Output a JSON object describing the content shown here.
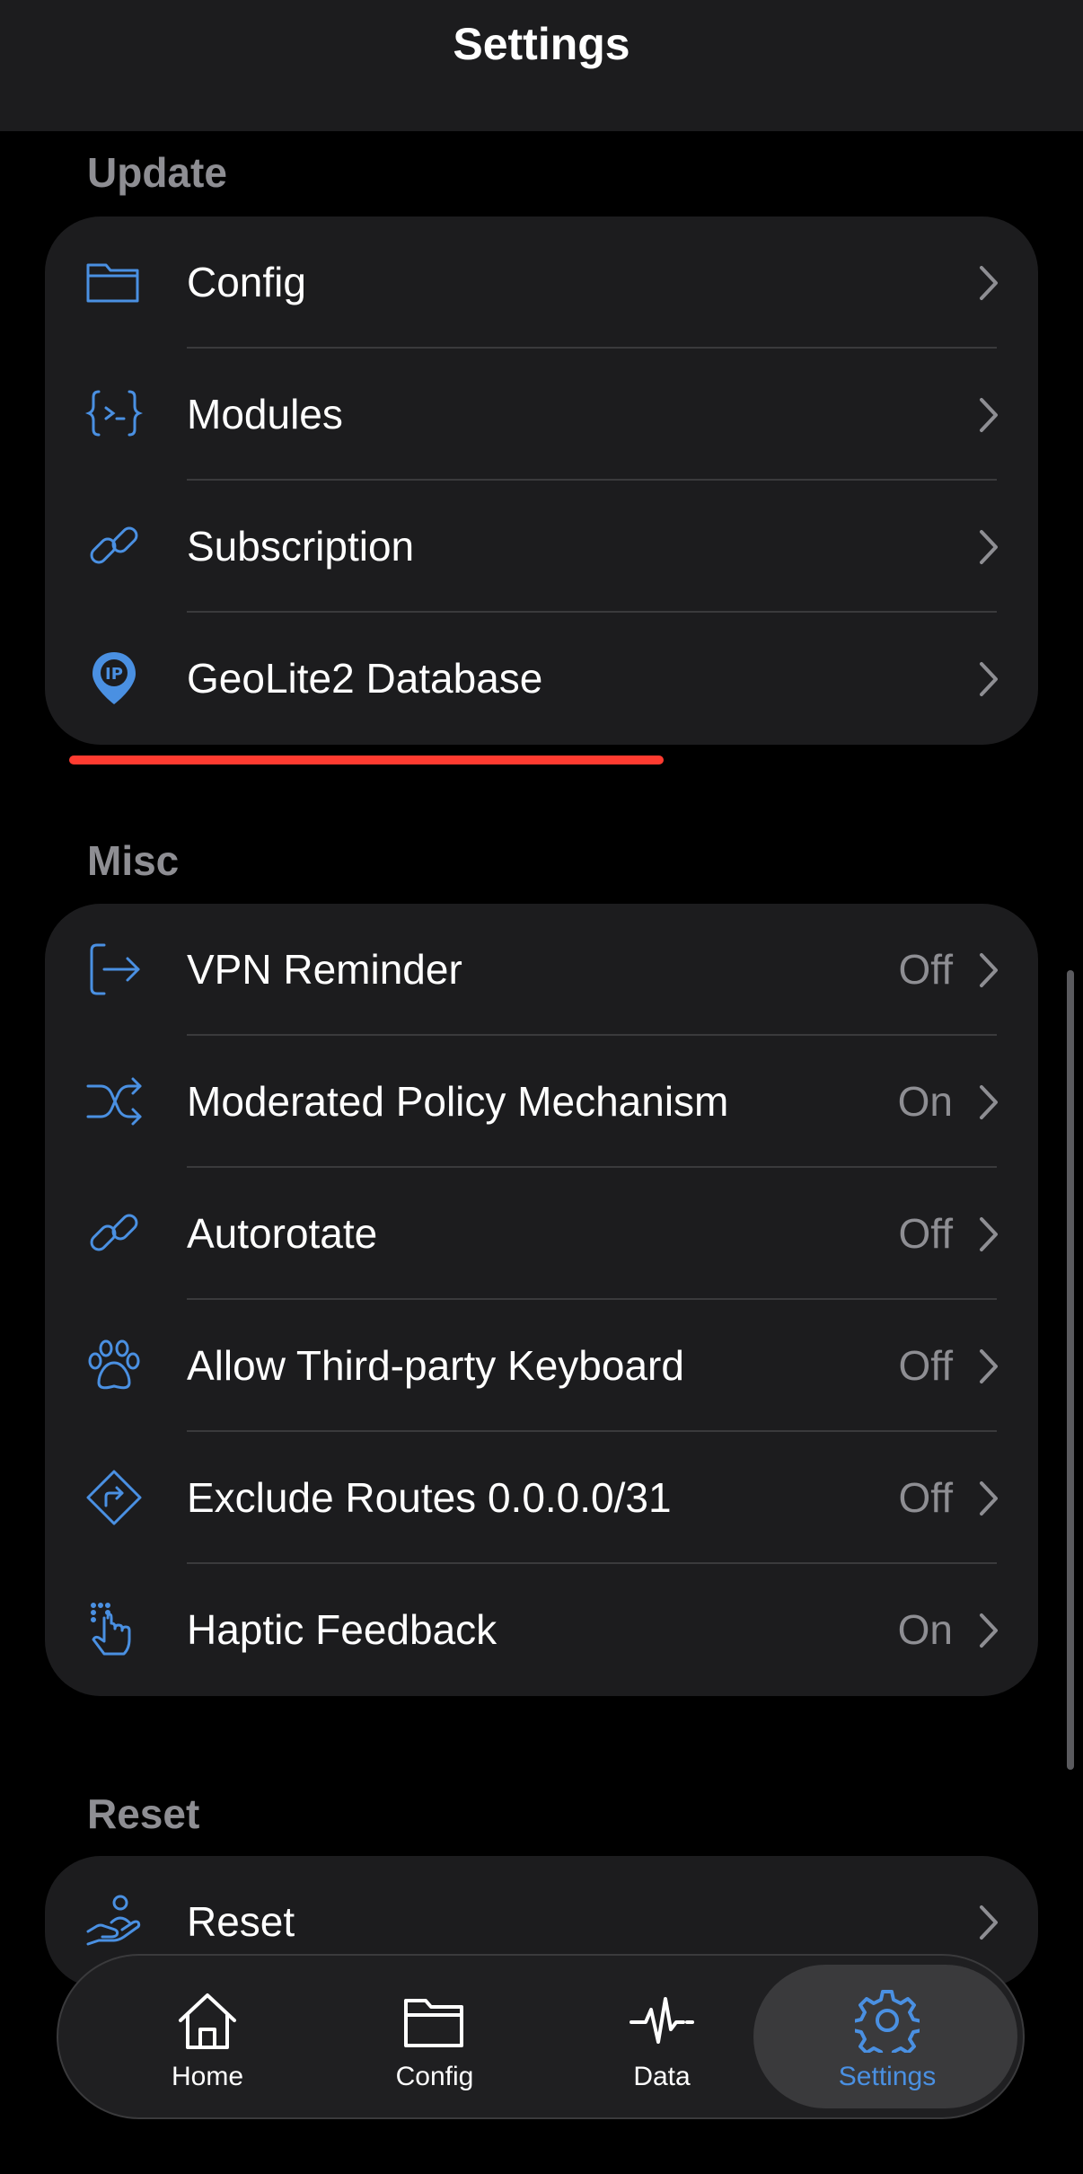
{
  "nav": {
    "title": "Settings"
  },
  "sections": {
    "update": {
      "header": "Update",
      "rows": [
        {
          "label": "Config",
          "icon": "folder-icon"
        },
        {
          "label": "Modules",
          "icon": "code-braces-icon"
        },
        {
          "label": "Subscription",
          "icon": "link-icon"
        },
        {
          "label": "GeoLite2 Database",
          "icon": "ip-location-pin-icon",
          "badge": "IP"
        }
      ]
    },
    "misc": {
      "header": "Misc",
      "rows": [
        {
          "label": "VPN Reminder",
          "value": "Off",
          "icon": "exit-arrow-icon"
        },
        {
          "label": "Moderated Policy Mechanism",
          "value": "On",
          "icon": "shuffle-icon"
        },
        {
          "label": "Autorotate",
          "value": "Off",
          "icon": "link-icon"
        },
        {
          "label": "Allow Third-party Keyboard",
          "value": "Off",
          "icon": "paw-icon"
        },
        {
          "label": "Exclude Routes 0.0.0.0/31",
          "value": "Off",
          "icon": "route-diamond-icon"
        },
        {
          "label": "Haptic Feedback",
          "value": "On",
          "icon": "tap-hand-icon"
        }
      ]
    },
    "reset": {
      "header": "Reset",
      "rows": [
        {
          "label": "Reset",
          "icon": "hand-person-icon"
        }
      ]
    }
  },
  "tabbar": {
    "tabs": [
      {
        "label": "Home",
        "icon": "house-icon",
        "active": false
      },
      {
        "label": "Config",
        "icon": "folder-icon",
        "active": false
      },
      {
        "label": "Data",
        "icon": "waveform-icon",
        "active": false
      },
      {
        "label": "Settings",
        "icon": "gear-icon",
        "active": true
      }
    ]
  },
  "colors": {
    "accent": "#4a90e2",
    "background": "#000000",
    "cell": "#1c1c1e",
    "secondary_text": "#8e8e93",
    "annotation_underline": "#ff3b30"
  }
}
